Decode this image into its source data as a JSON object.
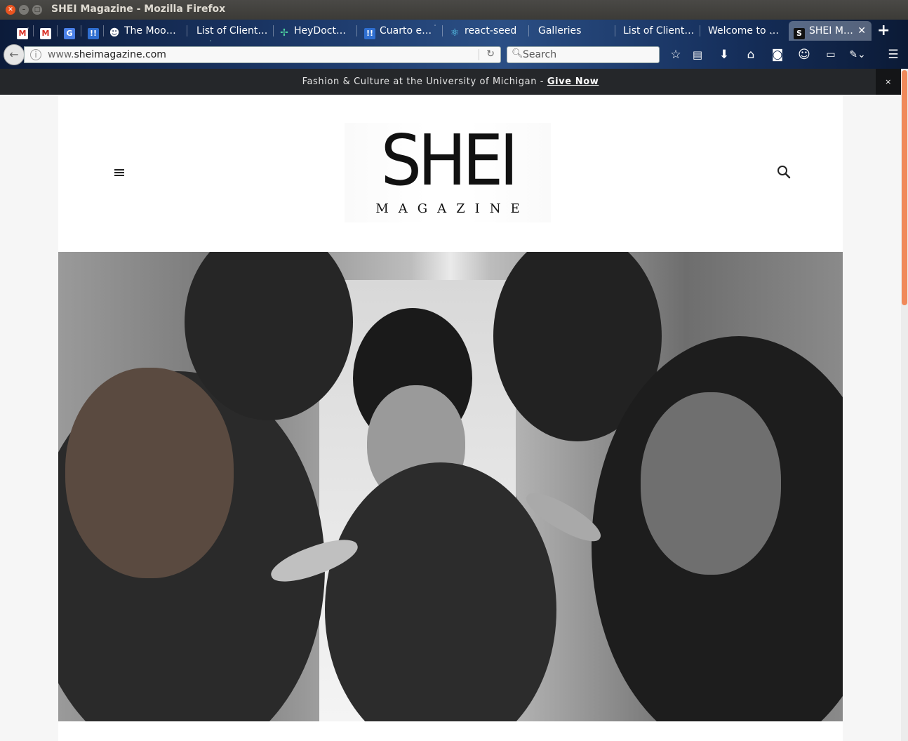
{
  "window": {
    "title": "SHEI Magazine - Mozilla Firefox"
  },
  "tabs": [
    {
      "label": "",
      "icon": "gmail-icon"
    },
    {
      "label": "",
      "icon": "gmail-icon"
    },
    {
      "label": "",
      "icon": "translate-icon"
    },
    {
      "label": "",
      "icon": "app-icon"
    },
    {
      "label": "The Moo…",
      "icon": "smiley-icon"
    },
    {
      "label": "List of Client…",
      "icon": ""
    },
    {
      "label": "HeyDoct…",
      "icon": "sparkle-icon"
    },
    {
      "label": "Cuarto e…",
      "icon": "app-icon"
    },
    {
      "label": "react-seed",
      "icon": "react-icon"
    },
    {
      "label": "Galleries",
      "icon": ""
    },
    {
      "label": "List of Client…",
      "icon": ""
    },
    {
      "label": "Welcome to …",
      "icon": ""
    },
    {
      "label": "SHEI M…",
      "icon": "shei-icon",
      "active": true
    }
  ],
  "navbar": {
    "url_prefix": "www.",
    "url_domain": "sheimagazine.com",
    "search_placeholder": "Search"
  },
  "notice": {
    "text": "Fashion & Culture at the University of Michigan - ",
    "link": "Give Now",
    "close": "×"
  },
  "site": {
    "logo_main": "SHEI",
    "logo_sub": "MAGAZINE"
  },
  "colors": {
    "accent": "#e95420",
    "scroll_thumb": "#f0895a",
    "notice_bg": "#25272a"
  }
}
